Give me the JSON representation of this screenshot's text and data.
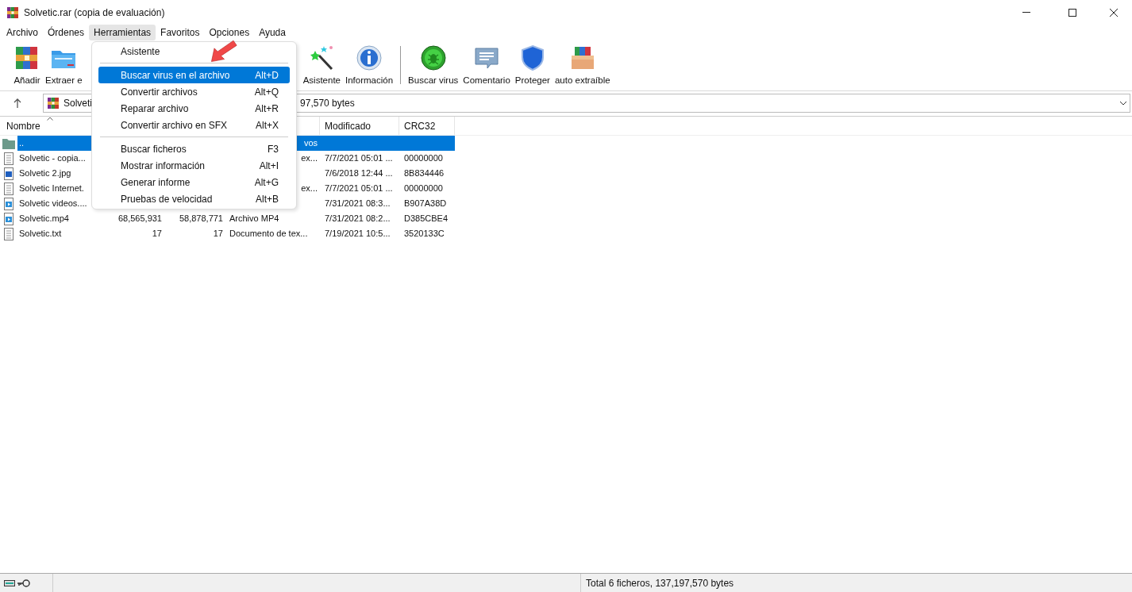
{
  "window": {
    "title": "Solvetic.rar (copia de evaluación)"
  },
  "menubar": [
    {
      "label": "Archivo",
      "selected": false
    },
    {
      "label": "Órdenes",
      "selected": false
    },
    {
      "label": "Herramientas",
      "selected": true
    },
    {
      "label": "Favoritos",
      "selected": false
    },
    {
      "label": "Opciones",
      "selected": false
    },
    {
      "label": "Ayuda",
      "selected": false
    }
  ],
  "toolbar": [
    {
      "label": "Añadir",
      "kind": "add"
    },
    {
      "label": "Extraer e",
      "kind": "extract"
    },
    {
      "label": "Asistente",
      "kind": "wizard"
    },
    {
      "label": "Información",
      "kind": "info"
    },
    {
      "kind": "separator"
    },
    {
      "label": "Buscar virus",
      "kind": "virus"
    },
    {
      "label": "Comentario",
      "kind": "comment"
    },
    {
      "label": "Proteger",
      "kind": "protect"
    },
    {
      "label": "auto extraíble",
      "kind": "sfx"
    }
  ],
  "address": {
    "left": "Solveti",
    "right": "97,570 bytes"
  },
  "table": {
    "columns": [
      "Nombre",
      "Modificado",
      "CRC32"
    ],
    "rows": [
      {
        "kind": "folder",
        "name": "..",
        "type": "vos",
        "selected": true
      },
      {
        "kind": "text",
        "name": "Solvetic - copia...",
        "type": "ex...",
        "modified": "7/7/2021 05:01 ...",
        "crc": "00000000",
        "selected": false
      },
      {
        "kind": "image",
        "name": "Solvetic 2.jpg",
        "modified": "7/6/2018 12:44 ...",
        "crc": "8B834446",
        "selected": false
      },
      {
        "kind": "text",
        "name": "Solvetic Internet.",
        "type": "ex...",
        "modified": "7/7/2021 05:01 ...",
        "crc": "00000000",
        "selected": false
      },
      {
        "kind": "video",
        "name": "Solvetic videos....",
        "modified": "7/31/2021 08:3...",
        "crc": "B907A38D",
        "selected": false
      },
      {
        "kind": "video",
        "name": "Solvetic.mp4",
        "size": "68,565,931",
        "packed": "58,878,771",
        "type": "Archivo MP4",
        "modified": "7/31/2021 08:2...",
        "crc": "D385CBE4",
        "selected": false
      },
      {
        "kind": "text",
        "name": "Solvetic.txt",
        "size": "17",
        "packed": "17",
        "type": "Documento de tex...",
        "modified": "7/19/2021 10:5...",
        "crc": "3520133C",
        "selected": false
      }
    ]
  },
  "menu": {
    "items": [
      {
        "kind": "item",
        "label": "Asistente",
        "selected": false
      },
      {
        "kind": "separator"
      },
      {
        "kind": "item",
        "label": "Buscar virus en el archivo",
        "shortcut": "Alt+D",
        "selected": true
      },
      {
        "kind": "item",
        "label": "Convertir archivos",
        "shortcut": "Alt+Q",
        "selected": false
      },
      {
        "kind": "item",
        "label": "Reparar archivo",
        "shortcut": "Alt+R",
        "selected": false
      },
      {
        "kind": "item",
        "label": "Convertir archivo en SFX",
        "shortcut": "Alt+X",
        "selected": false
      },
      {
        "kind": "separator"
      },
      {
        "kind": "item",
        "label": "Buscar ficheros",
        "shortcut": "F3",
        "selected": false
      },
      {
        "kind": "item",
        "label": "Mostrar información",
        "shortcut": "Alt+I",
        "selected": false
      },
      {
        "kind": "item",
        "label": "Generar informe",
        "shortcut": "Alt+G",
        "selected": false
      },
      {
        "kind": "item",
        "label": "Pruebas de velocidad",
        "shortcut": "Alt+B",
        "selected": false
      }
    ]
  },
  "status_bar": {
    "text": "Total 6 ficheros, 137,197,570 bytes"
  }
}
